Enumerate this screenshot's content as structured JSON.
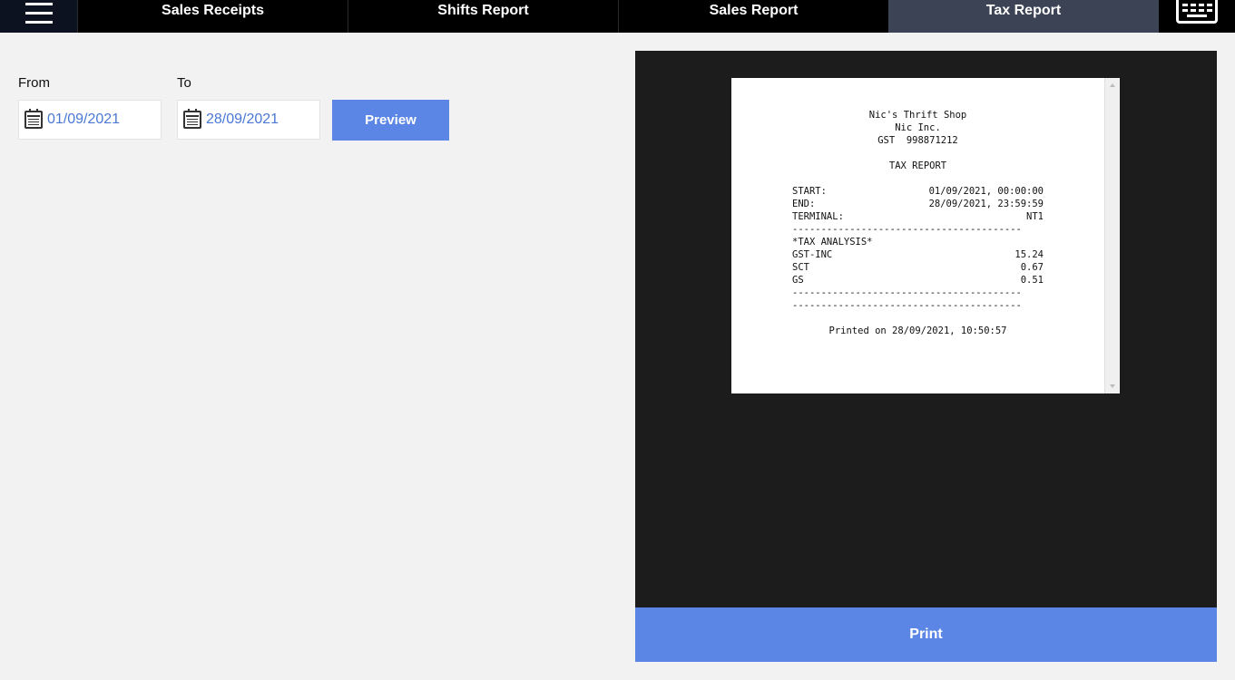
{
  "nav": {
    "tabs": [
      {
        "label": "Sales Receipts",
        "active": false
      },
      {
        "label": "Shifts Report",
        "active": false
      },
      {
        "label": "Sales Report",
        "active": false
      },
      {
        "label": "Tax Report",
        "active": true
      }
    ],
    "menu_icon": "hamburger-menu-icon",
    "keyboard_icon": "keyboard-icon"
  },
  "filters": {
    "from_label": "From",
    "to_label": "To",
    "from_value": "01/09/2021",
    "to_value": "28/09/2021",
    "preview_label": "Preview",
    "calendar_icon": "calendar-icon"
  },
  "receipt": {
    "shop_name": "Nic's Thrift Shop",
    "company": "Nic Inc.",
    "gst_line": "GST  998871212",
    "report_title": "TAX REPORT",
    "start_label": "START:",
    "start_value": "01/09/2021, 00:00:00",
    "end_label": "END:",
    "end_value": "28/09/2021, 23:59:59",
    "terminal_label": "TERMINAL:",
    "terminal_value": "NT1",
    "divider": "----------------------------------------",
    "analysis_title": "*TAX ANALYSIS*",
    "taxes": [
      {
        "name": "GST-INC",
        "amount": "15.24"
      },
      {
        "name": "SCT",
        "amount": "0.67"
      },
      {
        "name": "GS",
        "amount": "0.51"
      }
    ],
    "printed_on": "Printed on 28/09/2021, 10:50:57"
  },
  "actions": {
    "print_label": "Print"
  },
  "colors": {
    "accent": "#5b86e5",
    "active_tab": "#3c4354",
    "date_text": "#4a78d4",
    "preview_bg": "#1c1c1c"
  }
}
